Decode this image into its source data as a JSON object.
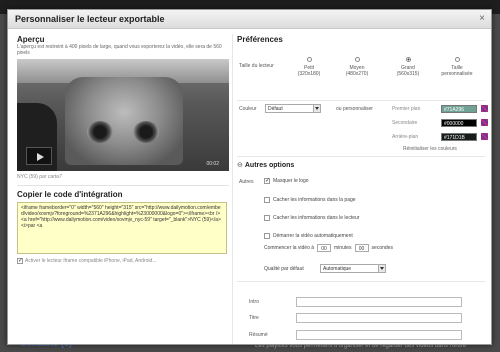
{
  "background": {
    "contacts": "Contacts (0)",
    "footer": "Les playlists vous permettent d'organiser et de regarder des vidéos dans l'ordre"
  },
  "modal": {
    "title": "Personnaliser le lecteur exportable",
    "close": "×"
  },
  "preview": {
    "heading": "Aperçu",
    "note": "L'aperçu est restreint à 400 pixels de large, quand vous exporterez la vidéo, elle sera de 560 pixels",
    "time": "00:02",
    "caption_title": "NYC (59)",
    "caption_by": "par carta7"
  },
  "embed": {
    "heading": "Copier le code d'intégration",
    "code": "<iframe frameborder=\"0\" width=\"560\" height=\"315\" src=\"http://www.dailymotion.com/embed/video/xovmjv?foreground=%2371A296&highlight=%23000000&logo=0\"></iframe><br /><a href=\"http://www.dailymotion.com/video/xovmjv_nyc-59\" target=\"_blank\">NYC (59)</a> <i>par <a",
    "iframe_option": "Activer le lecteur iframe compatible iPhone, iPad, Android..."
  },
  "preferences": {
    "heading": "Préférences",
    "size_label": "Taille du lecteur",
    "sizes": [
      {
        "name": "Petit",
        "dims": "(320x180)",
        "selected": false
      },
      {
        "name": "Moyen",
        "dims": "(480x270)",
        "selected": false
      },
      {
        "name": "Grand",
        "dims": "(560x315)",
        "selected": true
      },
      {
        "name": "Taille",
        "dims": "personnalisée",
        "selected": false
      }
    ],
    "color_label": "Couleur",
    "color_select": "Défaut",
    "or_customize": "ou personnaliser",
    "colors": [
      {
        "label": "Premier plan",
        "value": "#71A296",
        "bg": "#71a296"
      },
      {
        "label": "Secondaire",
        "value": "#000000",
        "bg": "#000000"
      },
      {
        "label": "Arrière-plan",
        "value": "#171D1B",
        "bg": "#171d1b"
      }
    ],
    "reset_colors": "Réinitialiser les couleurs"
  },
  "options": {
    "heading": "Autres options",
    "others_label": "Autres",
    "hide_logo": "Masquer le logo",
    "hide_info_page": "Cacher les informations dans la page",
    "hide_info_player": "Cacher les informations dans le lecteur",
    "autostart": "Démarrer la vidéo automatiquement",
    "start_at": "Commencer la vidéo à",
    "minutes_value": "00",
    "minutes": "minutes",
    "seconds_value": "00",
    "seconds": "secondes",
    "quality_label": "Qualité par défaut",
    "quality_value": "Automatique"
  },
  "text_fields": {
    "intro": "Intro",
    "title": "Titre",
    "summary": "Résumé"
  }
}
